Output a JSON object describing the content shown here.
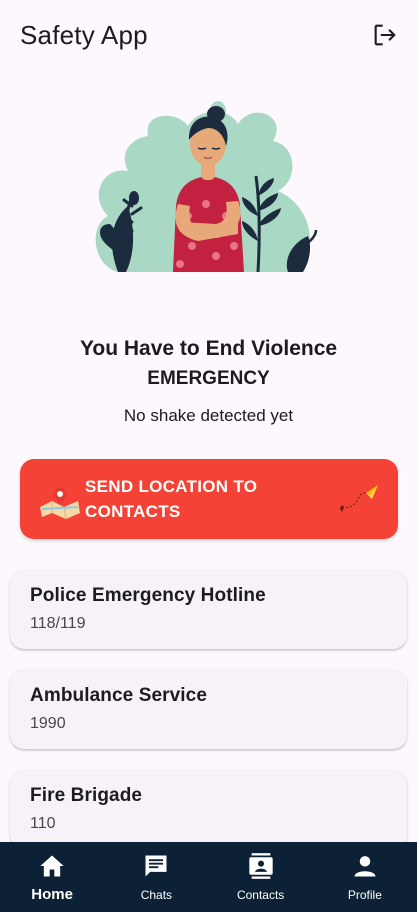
{
  "app": {
    "title": "Safety App",
    "logout_icon": "logout-icon"
  },
  "hero": {
    "headline": "You Have to End Violence",
    "subheadline": "EMERGENCY",
    "status": "No shake detected yet"
  },
  "send_button": {
    "label": "SEND LOCATION TO CONTACTS",
    "left_icon": "map-pin-icon",
    "right_icon": "paper-plane-icon",
    "color": "#f44336"
  },
  "hotlines": [
    {
      "name": "Police Emergency Hotline",
      "number": "118/119"
    },
    {
      "name": "Ambulance Service",
      "number": "1990"
    },
    {
      "name": "Fire Brigade",
      "number": "110"
    }
  ],
  "nav": {
    "items": [
      {
        "label": "Home",
        "icon": "home-icon",
        "active": true
      },
      {
        "label": "Chats",
        "icon": "chat-icon",
        "active": false
      },
      {
        "label": "Contacts",
        "icon": "contacts-icon",
        "active": false
      },
      {
        "label": "Profile",
        "icon": "person-icon",
        "active": false
      }
    ],
    "background": "#0c2136"
  }
}
